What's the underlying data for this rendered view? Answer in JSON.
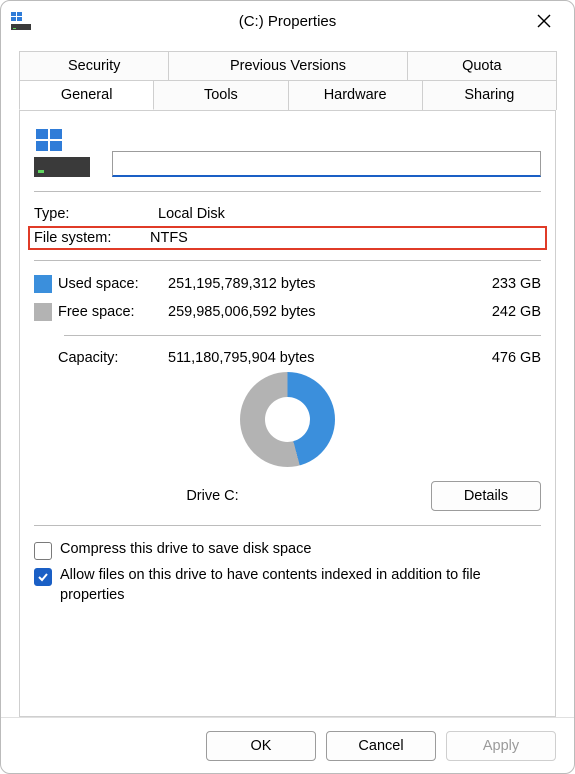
{
  "window": {
    "title": "(C:) Properties"
  },
  "tabs_row1": [
    "Security",
    "Previous Versions",
    "Quota"
  ],
  "tabs_row2": [
    "General",
    "Tools",
    "Hardware",
    "Sharing"
  ],
  "general": {
    "type_label": "Type:",
    "type_value": "Local Disk",
    "fs_label": "File system:",
    "fs_value": "NTFS",
    "used_label": "Used space:",
    "used_bytes": "251,195,789,312 bytes",
    "used_gb": "233 GB",
    "free_label": "Free space:",
    "free_bytes": "259,985,006,592 bytes",
    "free_gb": "242 GB",
    "cap_label": "Capacity:",
    "cap_bytes": "511,180,795,904 bytes",
    "cap_gb": "476 GB",
    "drive_label": "Drive C:",
    "details_btn": "Details",
    "compress_label": "Compress this drive to save disk space",
    "index_label": "Allow files on this drive to have contents indexed in addition to file properties"
  },
  "footer": {
    "ok": "OK",
    "cancel": "Cancel",
    "apply": "Apply"
  }
}
